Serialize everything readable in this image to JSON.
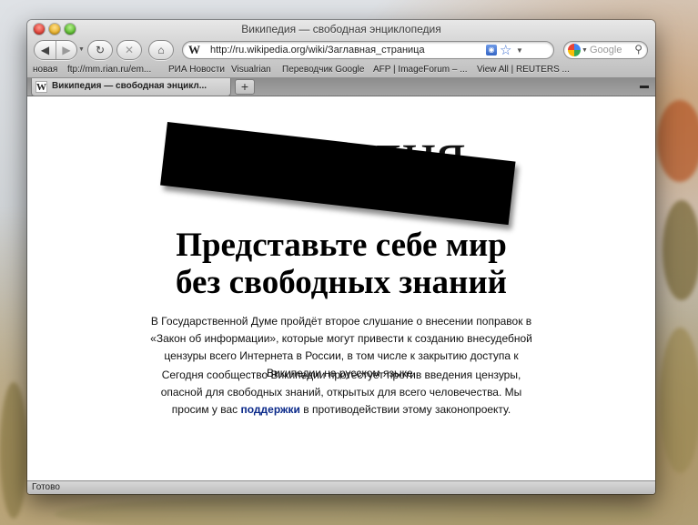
{
  "window": {
    "title": "Википедия — свободная энциклопедия"
  },
  "toolbar": {
    "back_icon": "◀",
    "forward_icon": "▶",
    "reload_icon": "↻",
    "stop_icon": "✕",
    "home_icon": "⌂"
  },
  "address_bar": {
    "favicon": "W",
    "url": "http://ru.wikipedia.org/wiki/Заглавная_страница"
  },
  "search": {
    "placeholder": "Google"
  },
  "bookmarks": [
    "новая",
    "ftp://mm.rian.ru/em...",
    "РИА Новости",
    "Visualrian",
    "Переводчик Google",
    "AFP | ImageForum – ...",
    "View All | REUTERS ..."
  ],
  "tabs": [
    {
      "favicon": "W",
      "title": "Википедия — свободная энцикл..."
    }
  ],
  "newtab_label": "+",
  "page": {
    "logo_text": "Википедия",
    "headline_line1": "Представьте себе мир",
    "headline_line2": "без свободных знаний",
    "para1": "В Государственной Думе пройдёт второе слушание о внесении поправок в «Закон об информации», которые могут привести к созданию внесудебной цензуры всего Интернета в России, в том числе к закрытию доступа к Википедии на русском языке.",
    "para2_before": "Сегодня сообщество Википедии протестует против введения цензуры, опасной для свободных знаний, открытых для всего человечества. Мы просим у вас ",
    "para2_link": "поддержки",
    "para2_after": " в противодействии этому законопроекту."
  },
  "status": {
    "text": "Готово"
  },
  "colors": {
    "link": "#0b2a8a",
    "rss": "#3465c5"
  }
}
